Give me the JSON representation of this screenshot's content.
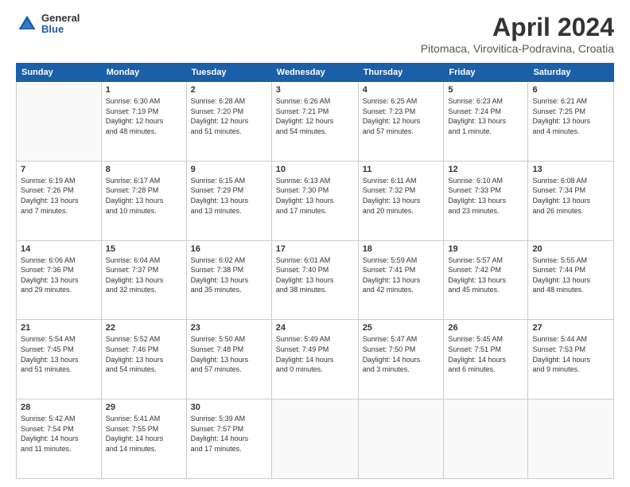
{
  "header": {
    "logo": {
      "general": "General",
      "blue": "Blue"
    },
    "title": "April 2024",
    "subtitle": "Pitomaca, Virovitica-Podravina, Croatia"
  },
  "calendar": {
    "weekdays": [
      "Sunday",
      "Monday",
      "Tuesday",
      "Wednesday",
      "Thursday",
      "Friday",
      "Saturday"
    ],
    "weeks": [
      [
        {
          "day": "",
          "info": ""
        },
        {
          "day": "1",
          "info": "Sunrise: 6:30 AM\nSunset: 7:19 PM\nDaylight: 12 hours\nand 48 minutes."
        },
        {
          "day": "2",
          "info": "Sunrise: 6:28 AM\nSunset: 7:20 PM\nDaylight: 12 hours\nand 51 minutes."
        },
        {
          "day": "3",
          "info": "Sunrise: 6:26 AM\nSunset: 7:21 PM\nDaylight: 12 hours\nand 54 minutes."
        },
        {
          "day": "4",
          "info": "Sunrise: 6:25 AM\nSunset: 7:23 PM\nDaylight: 12 hours\nand 57 minutes."
        },
        {
          "day": "5",
          "info": "Sunrise: 6:23 AM\nSunset: 7:24 PM\nDaylight: 13 hours\nand 1 minute."
        },
        {
          "day": "6",
          "info": "Sunrise: 6:21 AM\nSunset: 7:25 PM\nDaylight: 13 hours\nand 4 minutes."
        }
      ],
      [
        {
          "day": "7",
          "info": "Sunrise: 6:19 AM\nSunset: 7:26 PM\nDaylight: 13 hours\nand 7 minutes."
        },
        {
          "day": "8",
          "info": "Sunrise: 6:17 AM\nSunset: 7:28 PM\nDaylight: 13 hours\nand 10 minutes."
        },
        {
          "day": "9",
          "info": "Sunrise: 6:15 AM\nSunset: 7:29 PM\nDaylight: 13 hours\nand 13 minutes."
        },
        {
          "day": "10",
          "info": "Sunrise: 6:13 AM\nSunset: 7:30 PM\nDaylight: 13 hours\nand 17 minutes."
        },
        {
          "day": "11",
          "info": "Sunrise: 6:11 AM\nSunset: 7:32 PM\nDaylight: 13 hours\nand 20 minutes."
        },
        {
          "day": "12",
          "info": "Sunrise: 6:10 AM\nSunset: 7:33 PM\nDaylight: 13 hours\nand 23 minutes."
        },
        {
          "day": "13",
          "info": "Sunrise: 6:08 AM\nSunset: 7:34 PM\nDaylight: 13 hours\nand 26 minutes."
        }
      ],
      [
        {
          "day": "14",
          "info": "Sunrise: 6:06 AM\nSunset: 7:36 PM\nDaylight: 13 hours\nand 29 minutes."
        },
        {
          "day": "15",
          "info": "Sunrise: 6:04 AM\nSunset: 7:37 PM\nDaylight: 13 hours\nand 32 minutes."
        },
        {
          "day": "16",
          "info": "Sunrise: 6:02 AM\nSunset: 7:38 PM\nDaylight: 13 hours\nand 35 minutes."
        },
        {
          "day": "17",
          "info": "Sunrise: 6:01 AM\nSunset: 7:40 PM\nDaylight: 13 hours\nand 38 minutes."
        },
        {
          "day": "18",
          "info": "Sunrise: 5:59 AM\nSunset: 7:41 PM\nDaylight: 13 hours\nand 42 minutes."
        },
        {
          "day": "19",
          "info": "Sunrise: 5:57 AM\nSunset: 7:42 PM\nDaylight: 13 hours\nand 45 minutes."
        },
        {
          "day": "20",
          "info": "Sunrise: 5:55 AM\nSunset: 7:44 PM\nDaylight: 13 hours\nand 48 minutes."
        }
      ],
      [
        {
          "day": "21",
          "info": "Sunrise: 5:54 AM\nSunset: 7:45 PM\nDaylight: 13 hours\nand 51 minutes."
        },
        {
          "day": "22",
          "info": "Sunrise: 5:52 AM\nSunset: 7:46 PM\nDaylight: 13 hours\nand 54 minutes."
        },
        {
          "day": "23",
          "info": "Sunrise: 5:50 AM\nSunset: 7:48 PM\nDaylight: 13 hours\nand 57 minutes."
        },
        {
          "day": "24",
          "info": "Sunrise: 5:49 AM\nSunset: 7:49 PM\nDaylight: 14 hours\nand 0 minutes."
        },
        {
          "day": "25",
          "info": "Sunrise: 5:47 AM\nSunset: 7:50 PM\nDaylight: 14 hours\nand 3 minutes."
        },
        {
          "day": "26",
          "info": "Sunrise: 5:45 AM\nSunset: 7:51 PM\nDaylight: 14 hours\nand 6 minutes."
        },
        {
          "day": "27",
          "info": "Sunrise: 5:44 AM\nSunset: 7:53 PM\nDaylight: 14 hours\nand 9 minutes."
        }
      ],
      [
        {
          "day": "28",
          "info": "Sunrise: 5:42 AM\nSunset: 7:54 PM\nDaylight: 14 hours\nand 11 minutes."
        },
        {
          "day": "29",
          "info": "Sunrise: 5:41 AM\nSunset: 7:55 PM\nDaylight: 14 hours\nand 14 minutes."
        },
        {
          "day": "30",
          "info": "Sunrise: 5:39 AM\nSunset: 7:57 PM\nDaylight: 14 hours\nand 17 minutes."
        },
        {
          "day": "",
          "info": ""
        },
        {
          "day": "",
          "info": ""
        },
        {
          "day": "",
          "info": ""
        },
        {
          "day": "",
          "info": ""
        }
      ]
    ]
  }
}
